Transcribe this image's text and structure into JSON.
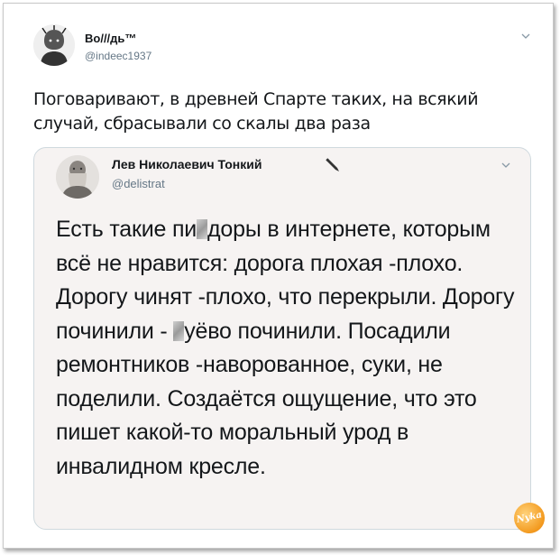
{
  "tweet": {
    "author_name": "Во///дь™",
    "author_handle": "@indeec1937",
    "text": "Поговаривают, в древней Спарте таких, на всякий случай, сбрасывали со скалы два раза",
    "menu_icon": "chevron-down-icon"
  },
  "quoted": {
    "author_name": "Лев Николаевич Тонкий",
    "author_handle": "@delistrat",
    "menu_icon": "chevron-down-icon",
    "text_parts": {
      "p1": "Есть такие пи",
      "p2": "доры в интернете, которым всё не нравится: дорога плохая -плохо. Дорогу чинят -плохо, что перекрыли. Дорогу починили - ",
      "p3": "уёво починили. Посадили ремонтников -наворованное, суки, не поделили. Создаётся ощущение, что это пишет какой-то моральный урод в инвалидном кресле."
    }
  },
  "watermark": {
    "label": "Nyka"
  },
  "colors": {
    "text": "#14171a",
    "secondary": "#657786",
    "quote_bg": "#f6f3f2",
    "border": "#cfd9de"
  }
}
